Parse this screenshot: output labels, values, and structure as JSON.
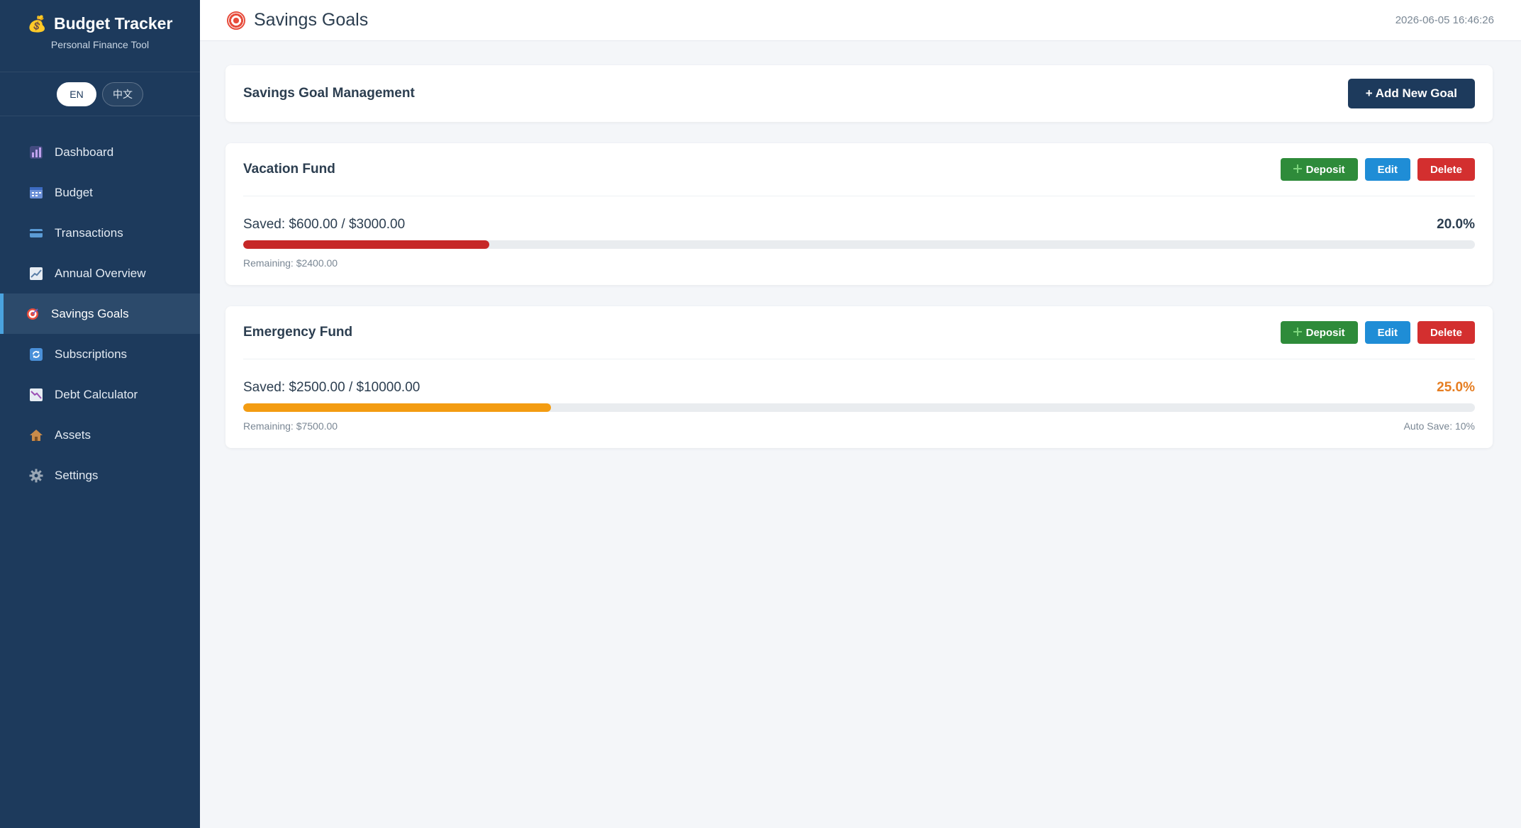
{
  "app": {
    "title": "Budget Tracker",
    "subtitle": "Personal Finance Tool"
  },
  "languages": [
    {
      "label": "EN",
      "active": true
    },
    {
      "label": "中文",
      "active": false
    }
  ],
  "sidebar": {
    "items": [
      {
        "label": "Dashboard",
        "icon": "bar-chart-icon",
        "color": "#8e6cc4"
      },
      {
        "label": "Budget",
        "icon": "calendar-icon",
        "color": "#6a8fd6"
      },
      {
        "label": "Transactions",
        "icon": "credit-card-icon",
        "color": "#5b9bd5"
      },
      {
        "label": "Annual Overview",
        "icon": "trend-chart-icon",
        "color": "#7b8fa8"
      },
      {
        "label": "Savings Goals",
        "icon": "target-icon",
        "color": "#e74c3c",
        "active": true
      },
      {
        "label": "Subscriptions",
        "icon": "refresh-icon",
        "color": "#4a90d9"
      },
      {
        "label": "Debt Calculator",
        "icon": "decline-chart-icon",
        "color": "#9b6fb5"
      },
      {
        "label": "Assets",
        "icon": "house-icon",
        "color": "#c98b4a"
      },
      {
        "label": "Settings",
        "icon": "gear-icon",
        "color": "#9aa7b5"
      }
    ]
  },
  "header": {
    "title": "Savings Goals",
    "timestamp": "2026-06-05 16:46:26"
  },
  "management": {
    "title": "Savings Goal Management",
    "add_button": "+ Add New Goal"
  },
  "goals": [
    {
      "name": "Vacation Fund",
      "saved_text": "Saved: $600.00 / $3000.00",
      "percent_text": "20.0%",
      "progress": 0.2,
      "remaining_text": "Remaining: $2400.00",
      "auto_save_text": "",
      "bar_color": "#c62828",
      "percent_color": "#2c3e50",
      "deposit_label": "Deposit",
      "edit_label": "Edit",
      "delete_label": "Delete"
    },
    {
      "name": "Emergency Fund",
      "saved_text": "Saved: $2500.00 / $10000.00",
      "percent_text": "25.0%",
      "progress": 0.25,
      "remaining_text": "Remaining: $7500.00",
      "auto_save_text": "Auto Save: 10%",
      "bar_color": "#f39c12",
      "percent_color": "#e67e22",
      "deposit_label": "Deposit",
      "edit_label": "Edit",
      "delete_label": "Delete"
    }
  ]
}
